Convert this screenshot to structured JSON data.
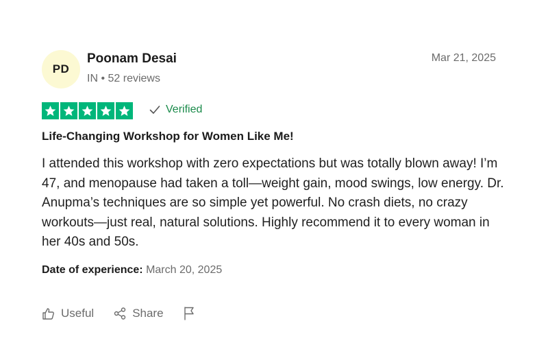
{
  "reviewer": {
    "initials": "PD",
    "name": "Poonam Desai",
    "meta": "IN • 52 reviews",
    "avatar_color": "#fcf9d3"
  },
  "review": {
    "date": "Mar 21, 2025",
    "rating": 5,
    "rating_max": 5,
    "star_color": "#00b67a",
    "verified_label": "Verified",
    "title": "Life-Changing Workshop for Women Like Me!",
    "body": "I attended this workshop with zero expectations but was totally blown away! I’m 47, and menopause had taken a toll—weight gain, mood swings, low energy. Dr. Anupma’s techniques are so simple yet powerful. No crash diets, no crazy workouts—just real, natural solutions. Highly recommend it to every woman in her 40s and 50s.",
    "date_of_experience_label": "Date of experience:",
    "date_of_experience": "March 20, 2025"
  },
  "actions": {
    "useful_label": "Useful",
    "share_label": "Share",
    "useful_icon": "thumbs-up-icon",
    "share_icon": "share-icon",
    "report_icon": "flag-icon"
  }
}
